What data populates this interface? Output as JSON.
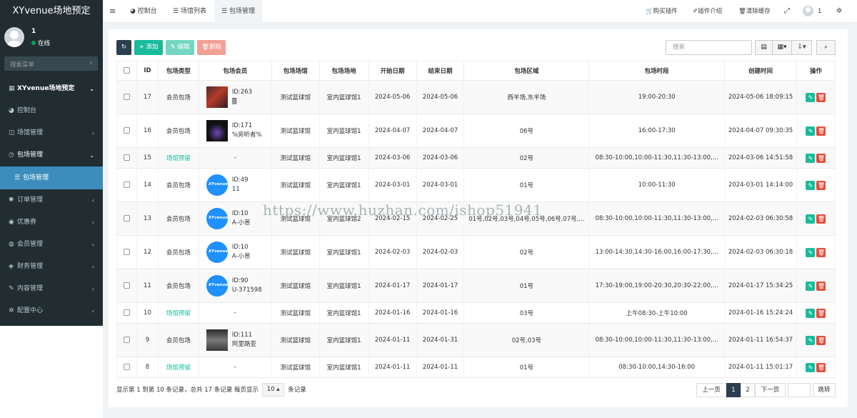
{
  "app": {
    "title": "XYvenue场地预定"
  },
  "user": {
    "name": "1",
    "status": "在线"
  },
  "sidebar": {
    "search_placeholder": "搜索菜单",
    "items": [
      {
        "label": "XYvenue场地预定",
        "icon": "grid-icon"
      },
      {
        "label": "控制台",
        "icon": "dashboard-icon"
      },
      {
        "label": "场馆管理",
        "icon": "square-icon"
      },
      {
        "label": "包场管理",
        "icon": "circle-clock-icon"
      },
      {
        "label": "包场管理",
        "icon": "list-icon"
      },
      {
        "label": "订单管理",
        "icon": "gear-icon"
      },
      {
        "label": "优惠券",
        "icon": "circle-icon"
      },
      {
        "label": "会员管理",
        "icon": "user-icon"
      },
      {
        "label": "财务管理",
        "icon": "diamond-icon"
      },
      {
        "label": "内容管理",
        "icon": "edit-icon"
      },
      {
        "label": "配置中心",
        "icon": "gear-icon"
      }
    ]
  },
  "topbar": {
    "tabs": [
      "控制台",
      "场馆列表",
      "包场管理"
    ],
    "right": [
      "购买插件",
      "插件介绍",
      "清除缓存",
      "1"
    ]
  },
  "toolbar": {
    "add": "添加",
    "edit": "编辑",
    "delete": "删除",
    "search_placeholder": "搜索"
  },
  "table": {
    "headers": [
      "ID",
      "包场类型",
      "包场会员",
      "包场场馆",
      "包场场地",
      "开始日期",
      "结束日期",
      "包场区域",
      "包场时段",
      "创建时间",
      "操作"
    ],
    "rows": [
      {
        "id": "17",
        "type": "会员包场",
        "member": [
          "ID:263",
          "🀫"
        ],
        "venue": "测试篮球馆",
        "court": "室内篮球馆1",
        "start": "2024-05-06",
        "end": "2024-05-06",
        "area": "西半场,东半场",
        "slot": "19:00-20:30",
        "created": "2024-05-06 18:09:15"
      },
      {
        "id": "16",
        "type": "会员包场",
        "member": [
          "ID:171",
          "%旁听者%"
        ],
        "venue": "测试篮球馆",
        "court": "室内篮球馆1",
        "start": "2024-04-07",
        "end": "2024-04-07",
        "area": "06号",
        "slot": "16:00-17:30",
        "created": "2024-04-07 09:30:35"
      },
      {
        "id": "15",
        "type": "场馆预留",
        "member": [
          "-"
        ],
        "venue": "测试篮球馆",
        "court": "室内篮球馆1",
        "start": "2024-03-06",
        "end": "2024-03-06",
        "area": "02号",
        "slot": "08:30-10:00,10:00-11:30,11:30-13:00,...",
        "created": "2024-03-06 14:51:58"
      },
      {
        "id": "14",
        "type": "会员包场",
        "member": [
          "ID:49",
          "11"
        ],
        "venue": "测试篮球馆",
        "court": "室内篮球馆1",
        "start": "2024-03-01",
        "end": "2024-03-01",
        "area": "01号",
        "slot": "10:00-11:30",
        "created": "2024-03-01 14:14:00"
      },
      {
        "id": "13",
        "type": "会员包场",
        "member": [
          "ID:10",
          "A-小葱"
        ],
        "venue": "测试篮球馆",
        "court": "室内篮球馆2",
        "start": "2024-02-15",
        "end": "2024-02-25",
        "area": "01号,02号,03号,04号,05号,06号,07号,...",
        "slot": "08:30-10:00,10:00-11:30,11:30-13:00,...",
        "created": "2024-02-03 06:30:58"
      },
      {
        "id": "12",
        "type": "会员包场",
        "member": [
          "ID:10",
          "A-小葱"
        ],
        "venue": "测试篮球馆",
        "court": "室内篮球馆1",
        "start": "2024-02-03",
        "end": "2024-02-03",
        "area": "02号",
        "slot": "13:00-14:30,14:30-16:00,16:00-17:30,...",
        "created": "2024-02-03 06:30:18"
      },
      {
        "id": "11",
        "type": "会员包场",
        "member": [
          "ID:90",
          "U-371598"
        ],
        "venue": "测试篮球馆",
        "court": "室内篮球馆1",
        "start": "2024-01-17",
        "end": "2024-01-17",
        "area": "01号",
        "slot": "17:30-19:00,19:00-20:30,20:30-22:00,...",
        "created": "2024-01-17 15:34:25"
      },
      {
        "id": "10",
        "type": "场馆预留",
        "member": [
          "-"
        ],
        "venue": "测试篮球馆",
        "court": "室内篮球馆1",
        "start": "2024-01-16",
        "end": "2024-01-16",
        "area": "03号",
        "slot": "上午08:30-上午10:00",
        "created": "2024-01-16 15:24:24"
      },
      {
        "id": "9",
        "type": "会员包场",
        "member": [
          "ID:111",
          "阿里路亚"
        ],
        "venue": "测试篮球馆",
        "court": "室内篮球馆1",
        "start": "2024-01-11",
        "end": "2024-01-31",
        "area": "02号,03号",
        "slot": "08:30-10:00,10:00-11:30,11:30-13:00,...",
        "created": "2024-01-11 16:54:37"
      },
      {
        "id": "8",
        "type": "场馆预留",
        "member": [
          "-"
        ],
        "venue": "测试篮球馆",
        "court": "室内篮球馆1",
        "start": "2024-01-11",
        "end": "2024-01-11",
        "area": "01号",
        "slot": "08:30-10:00,14:30-16:00",
        "created": "2024-01-11 15:01:17"
      }
    ]
  },
  "footer": {
    "summary_prefix": "显示第 1 到第 10 条记录，总共 17 条记录 每页显示",
    "page_size": "10",
    "summary_suffix": "条记录",
    "prev": "上一页",
    "pages": [
      "1",
      "2"
    ],
    "next": "下一页",
    "jump": "跳转"
  },
  "watermark": "https://www.huzhan.com/ishop51941",
  "colors": {
    "sidebar": "#222d32",
    "active": "#3c8dbc",
    "success": "#18bc9c",
    "danger": "#e74c3c"
  }
}
